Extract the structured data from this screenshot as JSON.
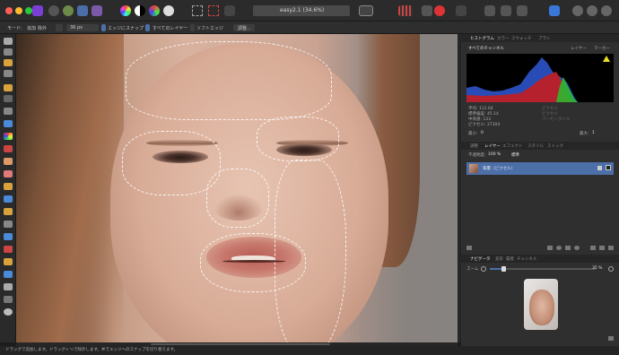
{
  "window": {
    "title": "easy2.1 (34.6%)"
  },
  "context_toolbar": {
    "mode_label": "モード:",
    "mode_add": "追加",
    "mode_subtract": "除外",
    "width_value": "36 px",
    "snap_edges": "エッジにスナップ",
    "all_layers": "すべてのレイヤー",
    "soft_edges": "ソフトエッジ",
    "refine_button": "調整..."
  },
  "histogram_panel": {
    "tabs": [
      "ヒストグラム",
      "カラー",
      "スウォッチ",
      "ブラシ"
    ],
    "channel_select": "すべてのチャンネル",
    "layer_button": "レイヤー",
    "marker_button": "マーカー",
    "stats_left": [
      "平均: 112.64",
      "標準偏差: 45.14",
      "中央値: 133",
      "ピクセル: 27304"
    ],
    "stats_right": [
      "ピクセル",
      "ピクセル",
      "パーセンタイル"
    ],
    "min_label": "最小:",
    "min_value": "0",
    "max_label": "最大:",
    "max_value": "1"
  },
  "layers_panel": {
    "tabs": [
      "調整",
      "レイヤー",
      "エフェクト",
      "スタイル",
      "ストック"
    ],
    "opacity_label": "不透明度:",
    "opacity_value": "100 %",
    "blend_mode": "標準",
    "layer_name": "背景",
    "layer_type": "(ピクセル)"
  },
  "navigator_panel": {
    "tabs": [
      "ナビゲータ",
      "変形",
      "履歴",
      "チャンネル"
    ],
    "zoom_label": "ズーム",
    "zoom_value": "35 %"
  },
  "status_bar": {
    "text": "ドラッグで追加します。ドラッグ+⌥で除外します。⌘でエッジへのスナップを切り替えます。"
  },
  "colors": {
    "accent": "#4d6fa8",
    "toolbar_bg": "#2b2b2b",
    "panel_bg": "#2f2f2f"
  }
}
